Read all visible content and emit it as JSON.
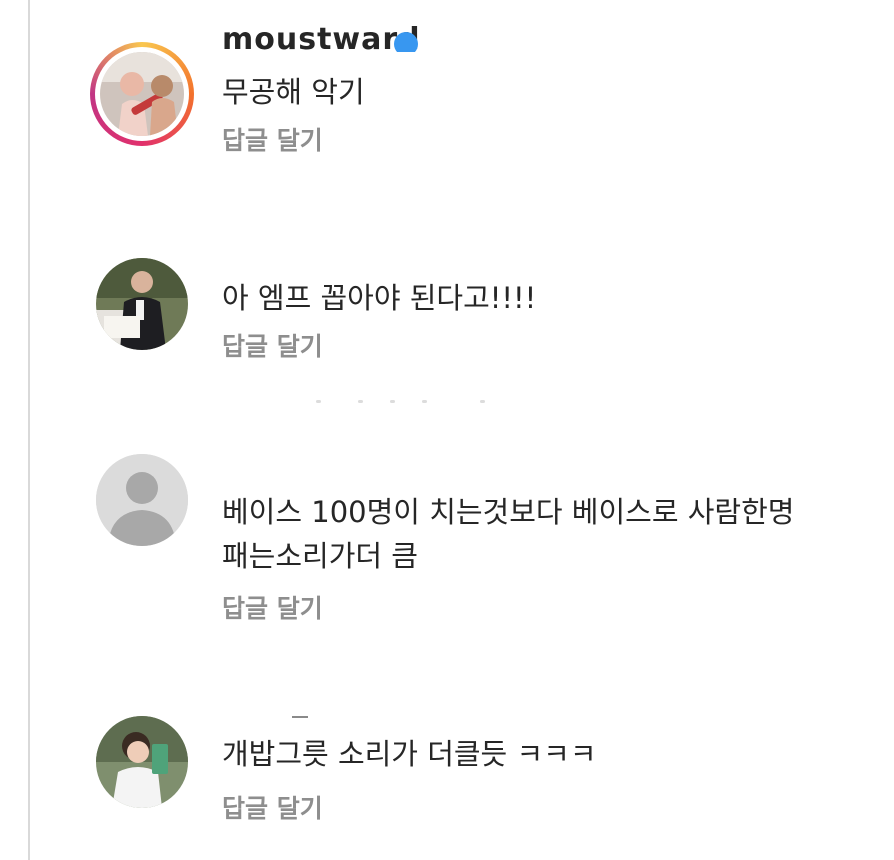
{
  "header_cutoff": {
    "username": "moustward"
  },
  "comments": [
    {
      "text": "무공해 악기",
      "reply_label": "답글 달기"
    },
    {
      "text": "아 엠프 꼽아야 된다고!!!!",
      "reply_label": "답글 달기"
    },
    {
      "text_line1": "베이스 100명이 치는것보다 베이스로 사람한명",
      "text_line2": "패는소리가더 큼",
      "reply_label": "답글 달기"
    },
    {
      "text": "개밥그릇 소리가 더클듯 ㅋㅋㅋ",
      "reply_label": "답글 달기"
    }
  ],
  "colors": {
    "text": "#262626",
    "secondary_text": "#8e8e8e",
    "default_avatar_bg": "#dbdbdb",
    "default_avatar_fg": "#a8a8a8"
  },
  "icons": {
    "verified": "verified-badge-icon",
    "default_avatar": "default-user-icon"
  }
}
